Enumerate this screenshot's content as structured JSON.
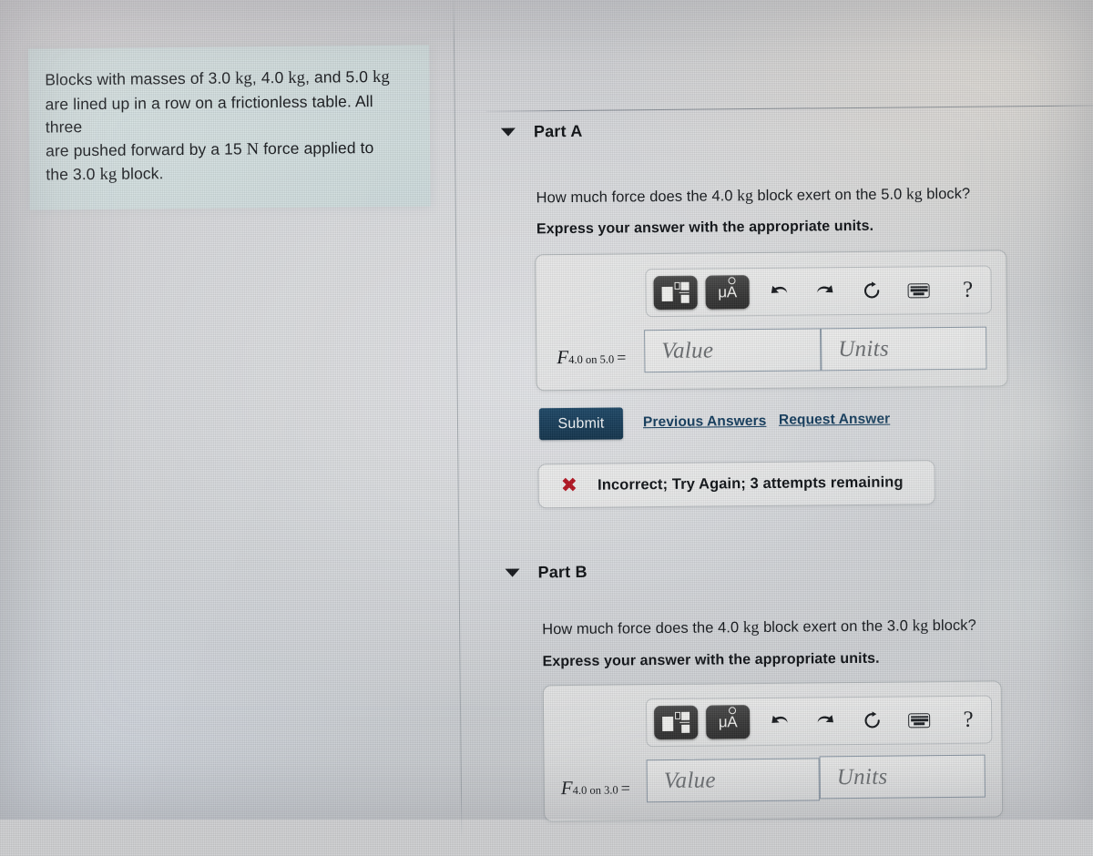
{
  "problem": {
    "text_part1": "Blocks with masses of 3.0 ",
    "kg1": "kg",
    "text_part2": ", 4.0 ",
    "kg2": "kg",
    "text_part3": ", and 5.0 ",
    "kg3": "kg",
    "line2": "are lined up in a row on a frictionless table. All three",
    "line3_a": "are pushed forward by a 15 ",
    "newton": "N",
    "line3_b": " force applied to",
    "line4_a": "the 3.0 ",
    "kg4": "kg",
    "line4_b": " block.",
    "full_text": "Blocks with masses of 3.0 kg, 4.0 kg, and 5.0 kg are lined up in a row on a frictionless table. All three are pushed forward by a 15 N force applied to the 3.0 kg block."
  },
  "toolbar": {
    "template_button_label": "math-template",
    "units_button_label": "μA",
    "units_mu": "μ",
    "units_a": "A",
    "undo_label": "Undo",
    "redo_label": "Redo",
    "reset_label": "Reset",
    "keyboard_label": "Keyboard shortcuts",
    "help_label": "?"
  },
  "parts": [
    {
      "id": "part-a",
      "title": "Part A",
      "question_lead": "How much force does the 4.0 ",
      "question_kg1": "kg",
      "question_mid": " block exert on the 5.0 ",
      "question_kg2": "kg",
      "question_tail": " block?",
      "question_full": "How much force does the 4.0 kg block exert on the 5.0 kg block?",
      "instruction": "Express your answer with the appropriate units.",
      "answer_label_F": "F",
      "answer_label_sub": "4.0 on 5.0",
      "answer_label_eq": "=",
      "value_placeholder": "Value",
      "value_text": "",
      "units_placeholder": "Units",
      "units_text": "",
      "submit_label": "Submit",
      "previous_answers_label": "Previous Answers",
      "request_answer_label": "Request Answer",
      "feedback_icon": "x-mark-icon",
      "feedback_text": "Incorrect; Try Again; 3 attempts remaining"
    },
    {
      "id": "part-b",
      "title": "Part B",
      "question_lead": "How much force does the 4.0 ",
      "question_kg1": "kg",
      "question_mid": " block exert on the 3.0 ",
      "question_kg2": "kg",
      "question_tail": " block?",
      "question_full": "How much force does the 4.0 kg block exert on the 3.0 kg block?",
      "instruction": "Express your answer with the appropriate units.",
      "answer_label_F": "F",
      "answer_label_sub": "4.0 on 3.0",
      "answer_label_eq": "=",
      "value_placeholder": "Value",
      "value_text": "",
      "units_placeholder": "Units",
      "units_text": ""
    }
  ],
  "colors": {
    "problem_box_bg": "#d3e0e0",
    "submit_bg": "#173c58",
    "link": "#113a5c",
    "error_red": "#b3121f",
    "field_border": "#8a98a6",
    "page_bg": "#cfd2d5"
  }
}
